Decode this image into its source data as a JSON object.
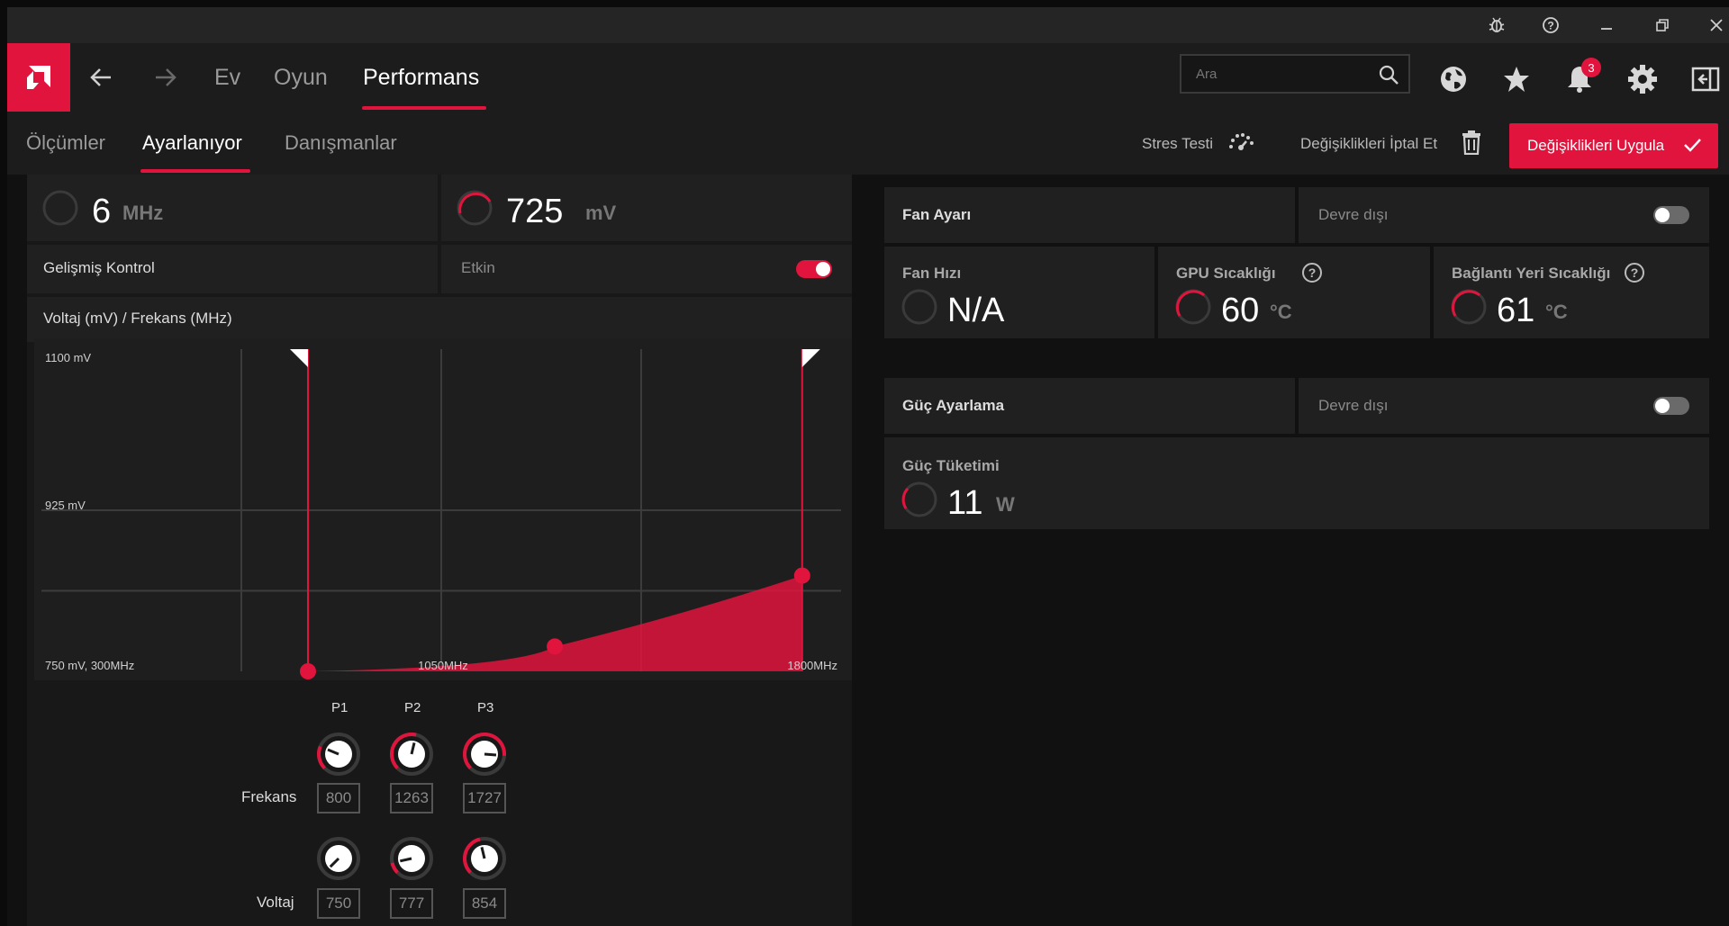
{
  "nav": {
    "home": "Ev",
    "gaming": "Oyun",
    "performance": "Performans",
    "search_placeholder": "Ara",
    "notifications_count": "3"
  },
  "subnav": {
    "metrics": "Ölçümler",
    "tuning": "Ayarlanıyor",
    "advisors": "Danışmanlar",
    "stress_test": "Stres Testi",
    "discard": "Değişiklikleri İptal Et",
    "apply": "Değişiklikleri Uygula"
  },
  "left": {
    "clock_value": "6",
    "clock_unit": "MHz",
    "voltage_value": "725",
    "voltage_unit": "mV",
    "advanced_label": "Gelişmiş Kontrol",
    "advanced_state": "Etkin",
    "advanced_enabled": true,
    "curve_title": "Voltaj (mV) / Frekans (MHz)"
  },
  "chart_data": {
    "type": "area",
    "title": "Voltaj (mV) / Frekans (MHz)",
    "y_tick_labels": [
      "1100 mV",
      "925 mV"
    ],
    "x_tick_labels": [
      "750 mV, 300MHz",
      "1050MHz",
      "1800MHz"
    ],
    "xlim": [
      300,
      1800
    ],
    "ylim": [
      750,
      1100
    ],
    "points": [
      {
        "name": "P1",
        "frequency": 800,
        "voltage": 750
      },
      {
        "name": "P2",
        "frequency": 1263,
        "voltage": 777
      },
      {
        "name": "P3",
        "frequency": 1727,
        "voltage": 854
      }
    ],
    "color": "#e0143c"
  },
  "states": {
    "labels": [
      "P1",
      "P2",
      "P3"
    ],
    "freq_label": "Frekans",
    "volt_label": "Voltaj",
    "frequency": [
      "800",
      "1263",
      "1727"
    ],
    "voltage": [
      "750",
      "777",
      "854"
    ]
  },
  "fan": {
    "title": "Fan Ayarı",
    "state": "Devre dışı",
    "speed_label": "Fan Hızı",
    "speed_value": "N/A",
    "gpu_temp_label": "GPU Sıcaklığı",
    "gpu_temp_value": "60",
    "junction_label": "Bağlantı Yeri Sıcaklığı",
    "junction_value": "61",
    "temp_unit": "°C"
  },
  "power": {
    "title": "Güç Ayarlama",
    "state": "Devre dışı",
    "consumption_label": "Güç Tüketimi",
    "consumption_value": "11",
    "consumption_unit": "W"
  }
}
